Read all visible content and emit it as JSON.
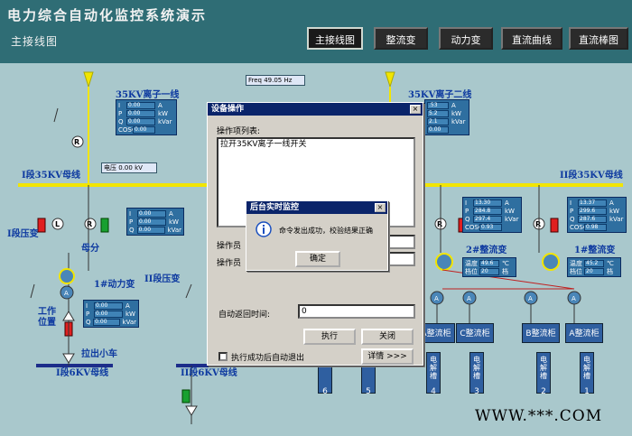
{
  "header": {
    "title": "电力综合自动化监控系统演示",
    "subtitle": "主接线图",
    "nav": [
      "主接线图",
      "整流变",
      "动力变",
      "直流曲线",
      "直流棒图"
    ]
  },
  "freq": "Freq 49.05 Hz",
  "voltage": {
    "label": "电压",
    "value": "0.00",
    "unit": "kV"
  },
  "lines": {
    "line1": "35KV离子一线",
    "line2": "35KV离子二线",
    "bus1": "I段35KV母线",
    "bus2": "II段35KV母线",
    "bus3": "I段6KV母线",
    "bus4": "II段6KV母线",
    "pt1": "I段压变",
    "pt2": "II段压变",
    "mufen": "母分",
    "power1": "1#动力变",
    "power2": "II段压变",
    "rect2": "2#整流变",
    "rect1": "1#整流变",
    "work_pos": "工作位置",
    "trolley": "拉出小车"
  },
  "meters": {
    "labels": [
      "I",
      "P",
      "Q",
      "COSΦ"
    ],
    "units": [
      "A",
      "kW",
      "kVar",
      ""
    ],
    "m1": [
      "0.00",
      "0.00",
      "0.00",
      "0.00"
    ],
    "m2": [
      "0.00",
      "0.00",
      "0.00",
      ""
    ],
    "m3": [
      "0.00",
      "0.00",
      "0.00",
      ""
    ],
    "m4": [
      "0.00",
      "0.00",
      "0.00",
      ""
    ],
    "m5": [
      ".53",
      "5.2",
      "2.1",
      "0.00"
    ],
    "m6": [
      "13.30",
      "284.8",
      "297.4",
      "0.93"
    ],
    "m7": [
      "13.37",
      "299.6",
      "287.6",
      "0.98"
    ]
  },
  "temps": {
    "t2": {
      "temp_label": "温度",
      "temp": "49.6",
      "temp_unit": "℃",
      "pos_label": "档位",
      "pos": "20",
      "pos_unit": "档"
    },
    "t1": {
      "temp_label": "温度",
      "temp": "45.2",
      "temp_unit": "℃",
      "pos_label": "档位",
      "pos": "20",
      "pos_unit": "档"
    }
  },
  "cabinets": [
    "A整流柜",
    "C整流柜",
    "B整流柜",
    "A整流柜"
  ],
  "cells": [
    {
      "label": "槽",
      "num": "6"
    },
    {
      "label": "槽",
      "num": "5"
    },
    {
      "label": "电解槽",
      "num": "4"
    },
    {
      "label": "电解槽",
      "num": "3"
    },
    {
      "label": "电解槽",
      "num": "2"
    },
    {
      "label": "电解槽",
      "num": "1"
    }
  ],
  "device_dialog": {
    "title": "设备操作",
    "list_label": "操作项列表:",
    "list_item": "拉开35KV离子一线开关",
    "operator1": "操作员",
    "operator2": "操作员",
    "auto_return_label": "自动返回时间:",
    "auto_return_value": "0",
    "execute": "执行",
    "close": "关闭",
    "details": "详情 >>>",
    "auto_exit": "执行成功后自动退出"
  },
  "msg_dialog": {
    "title": "后台实时监控",
    "message": "命令发出成功，校验结果正确",
    "ok": "确定",
    "close": "×"
  },
  "watermark": "WWW.***.COM"
}
